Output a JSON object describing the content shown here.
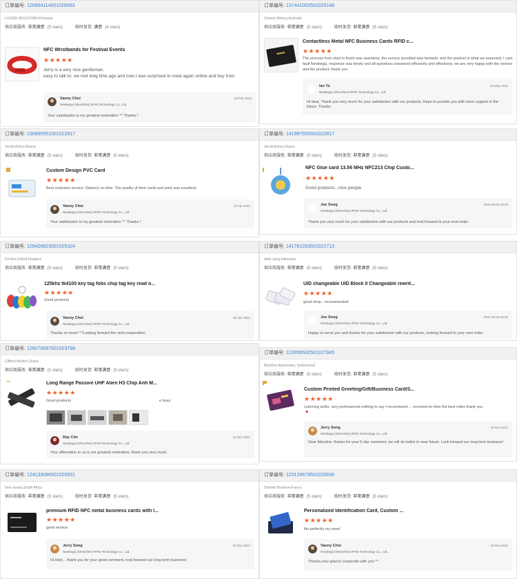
{
  "labels": {
    "order_prefix": "订单编号:",
    "supplier_service": "供应商服务:",
    "on_time_shipping": "按时发货:",
    "very_satisfied": "非常满意",
    "satisfied": "满意"
  },
  "colors": {
    "star": "#f0602b",
    "link": "#3a7fd0",
    "reply_bg": "#f5f6f8"
  },
  "reviews": [
    {
      "order_no": "120904114001026683",
      "buyer": "LUCIAN MOLDOVAN,Romania",
      "service_value": "非常满意",
      "service_count": "(5 stars)",
      "shipping_value": "满意",
      "shipping_count": "(4 stars)",
      "product": "NFC Wristbands for Festival Events",
      "stars": "★★★★★",
      "text": "Jerry is a very nice gentleman.\neasy to talk to. we met long time ago and now I was surprised to meet again online and buy from",
      "reply": {
        "name": "Vanny Choi",
        "company": "Newbega (Shenzhen) RFID Technology Co., Ltd.",
        "date": "28 Feb 2022",
        "message": "Your satisfaction is my greatest motivation ^^ Thanks !"
      }
    },
    {
      "order_no": "137441003501025148",
      "buyer": "Simone Molony,Australia",
      "service_value": "非常满意",
      "service_count": "(5 stars)",
      "shipping_value": "非常满意",
      "shipping_count": "(5 stars)",
      "product": "Contactless Metal NFC Business Cards RFID c...",
      "stars": "★★★★★",
      "text": "The process from start to finish was seamless, the service provided was fantastic and the product is what we expected.  I cant fault Newbega, response was timely and all questions answered efficiently and effectively.  we are very happy with the service and the product. thank you",
      "reply": {
        "name": "Ian Ye",
        "company": "Newbega (Shenzhen) RFID Technology Co., Ltd.",
        "date": "04 May 2022",
        "message": "Hi dear, Thank you very much for your satisfaction with our products, Hope to provide you with more support in the future. Thanks"
      }
    },
    {
      "order_no": "136895951001022817",
      "buyer": "Jerold Arthur,Ghana",
      "service_value": "非常满意",
      "service_count": "(5 stars)",
      "shipping_value": "非常满意",
      "shipping_count": "(5 stars)",
      "product": "Custom Design PVC Card",
      "stars": "★★★★★",
      "text": "Best customer service. Delivery on time. The quality of their cards and print was excellent.",
      "reply": {
        "name": "Vanny Choi",
        "company": "Newbega (Shenzhen) RFID Technology Co., Ltd.",
        "date": "13 Apr 2022",
        "message": "Your satisfaction is my greatest motivation ^^ Thanks !"
      }
    },
    {
      "order_no": "141997555501022817",
      "buyer": "Jerold Arthur,Ghana",
      "service_value": "非常满意",
      "service_count": "(5 stars)",
      "shipping_value": "非常满意",
      "shipping_count": "(5 stars)",
      "product": "NFC Glue card 13.56 MHz NFC213 Chip Custo...",
      "stars": "★★★★★",
      "text": "Good products...nice people",
      "reply": {
        "name": "Joe Song",
        "company": "Newbega (Shenzhen) RFID Technology Co., Ltd.",
        "date": "2022-06-29 23:30",
        "message": "Thank you very much for your satisfaction with our products and look forward to your next order."
      }
    },
    {
      "order_no": "128426823001025324",
      "buyer": "Kit Neo,United Kingdom",
      "service_value": "非常满意",
      "service_count": "(5 stars)",
      "shipping_value": "非常满意",
      "shipping_count": "(5 stars)",
      "product": "125khz tk4100 key tag fobs chip tag key read o...",
      "stars": "★★★★★",
      "text": "Good products",
      "reply": {
        "name": "Vanny Choi",
        "company": "Newbega (Shenzhen) RFID Technology Co., Ltd.",
        "date": "06 Jan 2022",
        "message": "Thanks so much ^^Looking forward the next cooperation."
      }
    },
    {
      "order_no": "141781283501022713",
      "buyer": "dedy tjong,Indonesia",
      "service_value": "非常满意",
      "service_count": "(5 stars)",
      "shipping_value": "非常满意",
      "shipping_count": "(5 stars)",
      "product": "UID changeable UID Block 0 Changeable rewrit...",
      "stars": "★★★★★",
      "text": "good shop.. recommended",
      "reply": {
        "name": "Joe Song",
        "company": "Newbega (Shenzhen) RFID Technology Co., Ltd.",
        "date": "2022-06-29 23:32",
        "message": "Happy to serve you and thanks for your satisfaction with our products, looking forward to your next order."
      }
    },
    {
      "order_no": "126079567001023798",
      "buyer": "Clifford Medoh,Ghana",
      "service_value": "非常满意",
      "service_count": "(5 stars)",
      "shipping_value": "非常满意",
      "shipping_count": "(5 stars)",
      "product": "Long Range Passive UHF Alien H3 Chip Anti M...",
      "stars": "★★★★★",
      "text": "Good products",
      "extra": "e busy",
      "reply": {
        "name": "Ray Che",
        "company": "Newbega (Shenzhen) RFID Technology Co., Ltd.",
        "date": "14 Dec 2021",
        "message": "Your affirmation to us is our greatest motivation, thank you very much."
      }
    },
    {
      "order_no": "123959502501027845",
      "buyer": "Maryline Apemewoe, Switzerland",
      "service_value": "非常满意",
      "service_count": "(5 stars)",
      "shipping_value": "非常满意",
      "shipping_count": "(5 stars)",
      "product": "Custom Printed Greeting/Gift/Business Card/S...",
      "stars": "★★★★★",
      "text": "Listening seller, very professional nothing to say I recommend ... received on time the best miles thank you",
      "reply": {
        "name": "Jerry Song",
        "company": "Newbega (Shenzhen) RFID Technology Co., Ltd.",
        "date": "15 Nov 2021",
        "message": "Dear Maryline, thanks for your 5 star comment, we will do better in near future. Look forward our long term business!"
      }
    },
    {
      "order_no": "124133086501020931",
      "buyer": "hein marais,South Africa",
      "service_value": "非常满意",
      "service_count": "(5 stars)",
      "shipping_value": "非常满意",
      "shipping_count": "(5 stars)",
      "product": "premium RFID NFC metal business cards with l...",
      "stars": "★★★★★",
      "text": "good service",
      "reply": {
        "name": "Jerry Song",
        "company": "Newbega (Shenzhen) RFID Technology Co., Ltd.",
        "date": "29 Nov 2021",
        "message": "Hi Hein, . thank you for your good comment, look forward our long term business!"
      }
    },
    {
      "order_no": "123129679501020836",
      "buyer": "Damien Bourdon,France",
      "service_value": "非常满意",
      "service_count": "(5 stars)",
      "shipping_value": "非常满意",
      "shipping_count": "(5 stars)",
      "product": "Personalized Identification Card, Custom ...",
      "stars": "★★★★★",
      "text": "fits perfectly my need",
      "reply": {
        "name": "Vanny Choi",
        "company": "Newbega (Shenzhen) RFID Technology Co., Ltd.",
        "date": "15 Nov 2021",
        "message": "Thanks,very glad to cooperate with you ^^"
      }
    }
  ]
}
